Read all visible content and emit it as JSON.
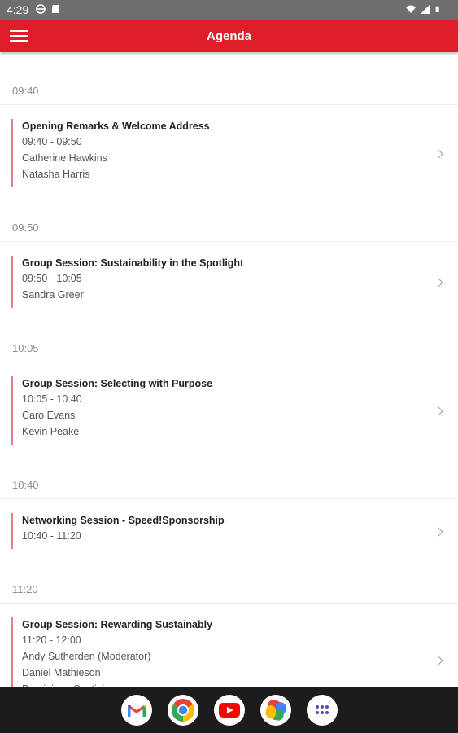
{
  "status_bar": {
    "time": "4:29",
    "icons_left": [
      "vpn-icon",
      "sd-card-icon"
    ],
    "icons_right": [
      "wifi-icon",
      "signal-icon",
      "battery-icon"
    ]
  },
  "app_bar": {
    "title": "Agenda",
    "menu_icon": "hamburger-menu-icon",
    "color": "#e11d2a"
  },
  "agenda": [
    {
      "time": "09:40",
      "sessions": [
        {
          "title": "Opening Remarks & Welcome Address",
          "time_range": "09:40 - 09:50",
          "speakers": [
            "Catherine Hawkins",
            "Natasha Harris"
          ]
        }
      ]
    },
    {
      "time": "09:50",
      "sessions": [
        {
          "title": "Group Session: Sustainability in the Spotlight",
          "time_range": "09:50 - 10:05",
          "speakers": [
            "Sandra Greer"
          ]
        }
      ]
    },
    {
      "time": "10:05",
      "sessions": [
        {
          "title": "Group Session: Selecting with Purpose",
          "time_range": "10:05 - 10:40",
          "speakers": [
            "Caro Evans",
            "Kevin Peake"
          ]
        }
      ]
    },
    {
      "time": "10:40",
      "sessions": [
        {
          "title": "Networking Session - Speed!Sponsorship",
          "time_range": "10:40 - 11:20",
          "speakers": []
        }
      ]
    },
    {
      "time": "11:20",
      "sessions": [
        {
          "title": "Group Session: Rewarding Sustainably",
          "time_range": "11:20 - 12:00",
          "speakers": [
            "Andy Sutherden (Moderator)",
            "Daniel Mathieson",
            "Dominique Santini"
          ]
        }
      ]
    }
  ],
  "dock": [
    {
      "name": "Gmail",
      "icon": "gmail-icon"
    },
    {
      "name": "Chrome",
      "icon": "chrome-icon"
    },
    {
      "name": "YouTube",
      "icon": "youtube-icon"
    },
    {
      "name": "Photos",
      "icon": "photos-icon"
    },
    {
      "name": "App drawer",
      "icon": "app-drawer-icon"
    }
  ]
}
